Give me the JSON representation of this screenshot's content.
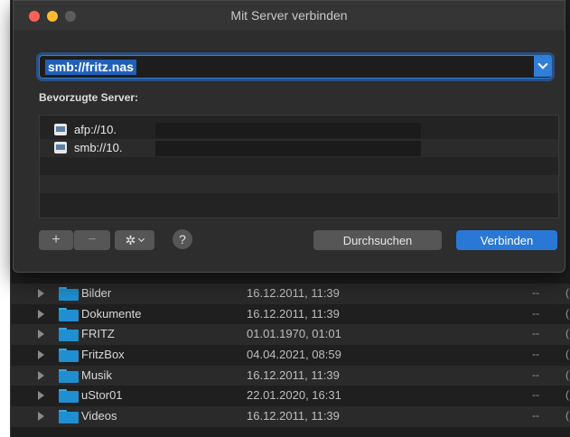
{
  "dialog": {
    "title": "Mit Server verbinden",
    "address_value": "smb://fritz.nas",
    "favorites_label": "Bevorzugte Server:",
    "favorites": [
      {
        "text": "afp://10."
      },
      {
        "text": "smb://10."
      }
    ],
    "buttons": {
      "add": "+",
      "remove": "−",
      "gear": "✲",
      "help": "?",
      "browse": "Durchsuchen",
      "connect": "Verbinden"
    },
    "colors": {
      "accent": "#2a78d6",
      "close": "#fe5f57",
      "minimize": "#febc2e"
    }
  },
  "finder": {
    "rows": [
      {
        "name": "Bilder",
        "date": "16.12.2011, 11:39",
        "size": "--",
        "kind": "("
      },
      {
        "name": "Dokumente",
        "date": "16.12.2011, 11:39",
        "size": "--",
        "kind": "("
      },
      {
        "name": "FRITZ",
        "date": "01.01.1970, 01:01",
        "size": "--",
        "kind": "("
      },
      {
        "name": "FritzBox",
        "date": "04.04.2021, 08:59",
        "size": "--",
        "kind": "("
      },
      {
        "name": "Musik",
        "date": "16.12.2011, 11:39",
        "size": "--",
        "kind": "("
      },
      {
        "name": "uStor01",
        "date": "22.01.2020, 16:31",
        "size": "--",
        "kind": "("
      },
      {
        "name": "Videos",
        "date": "16.12.2011, 11:39",
        "size": "--",
        "kind": "("
      }
    ]
  }
}
